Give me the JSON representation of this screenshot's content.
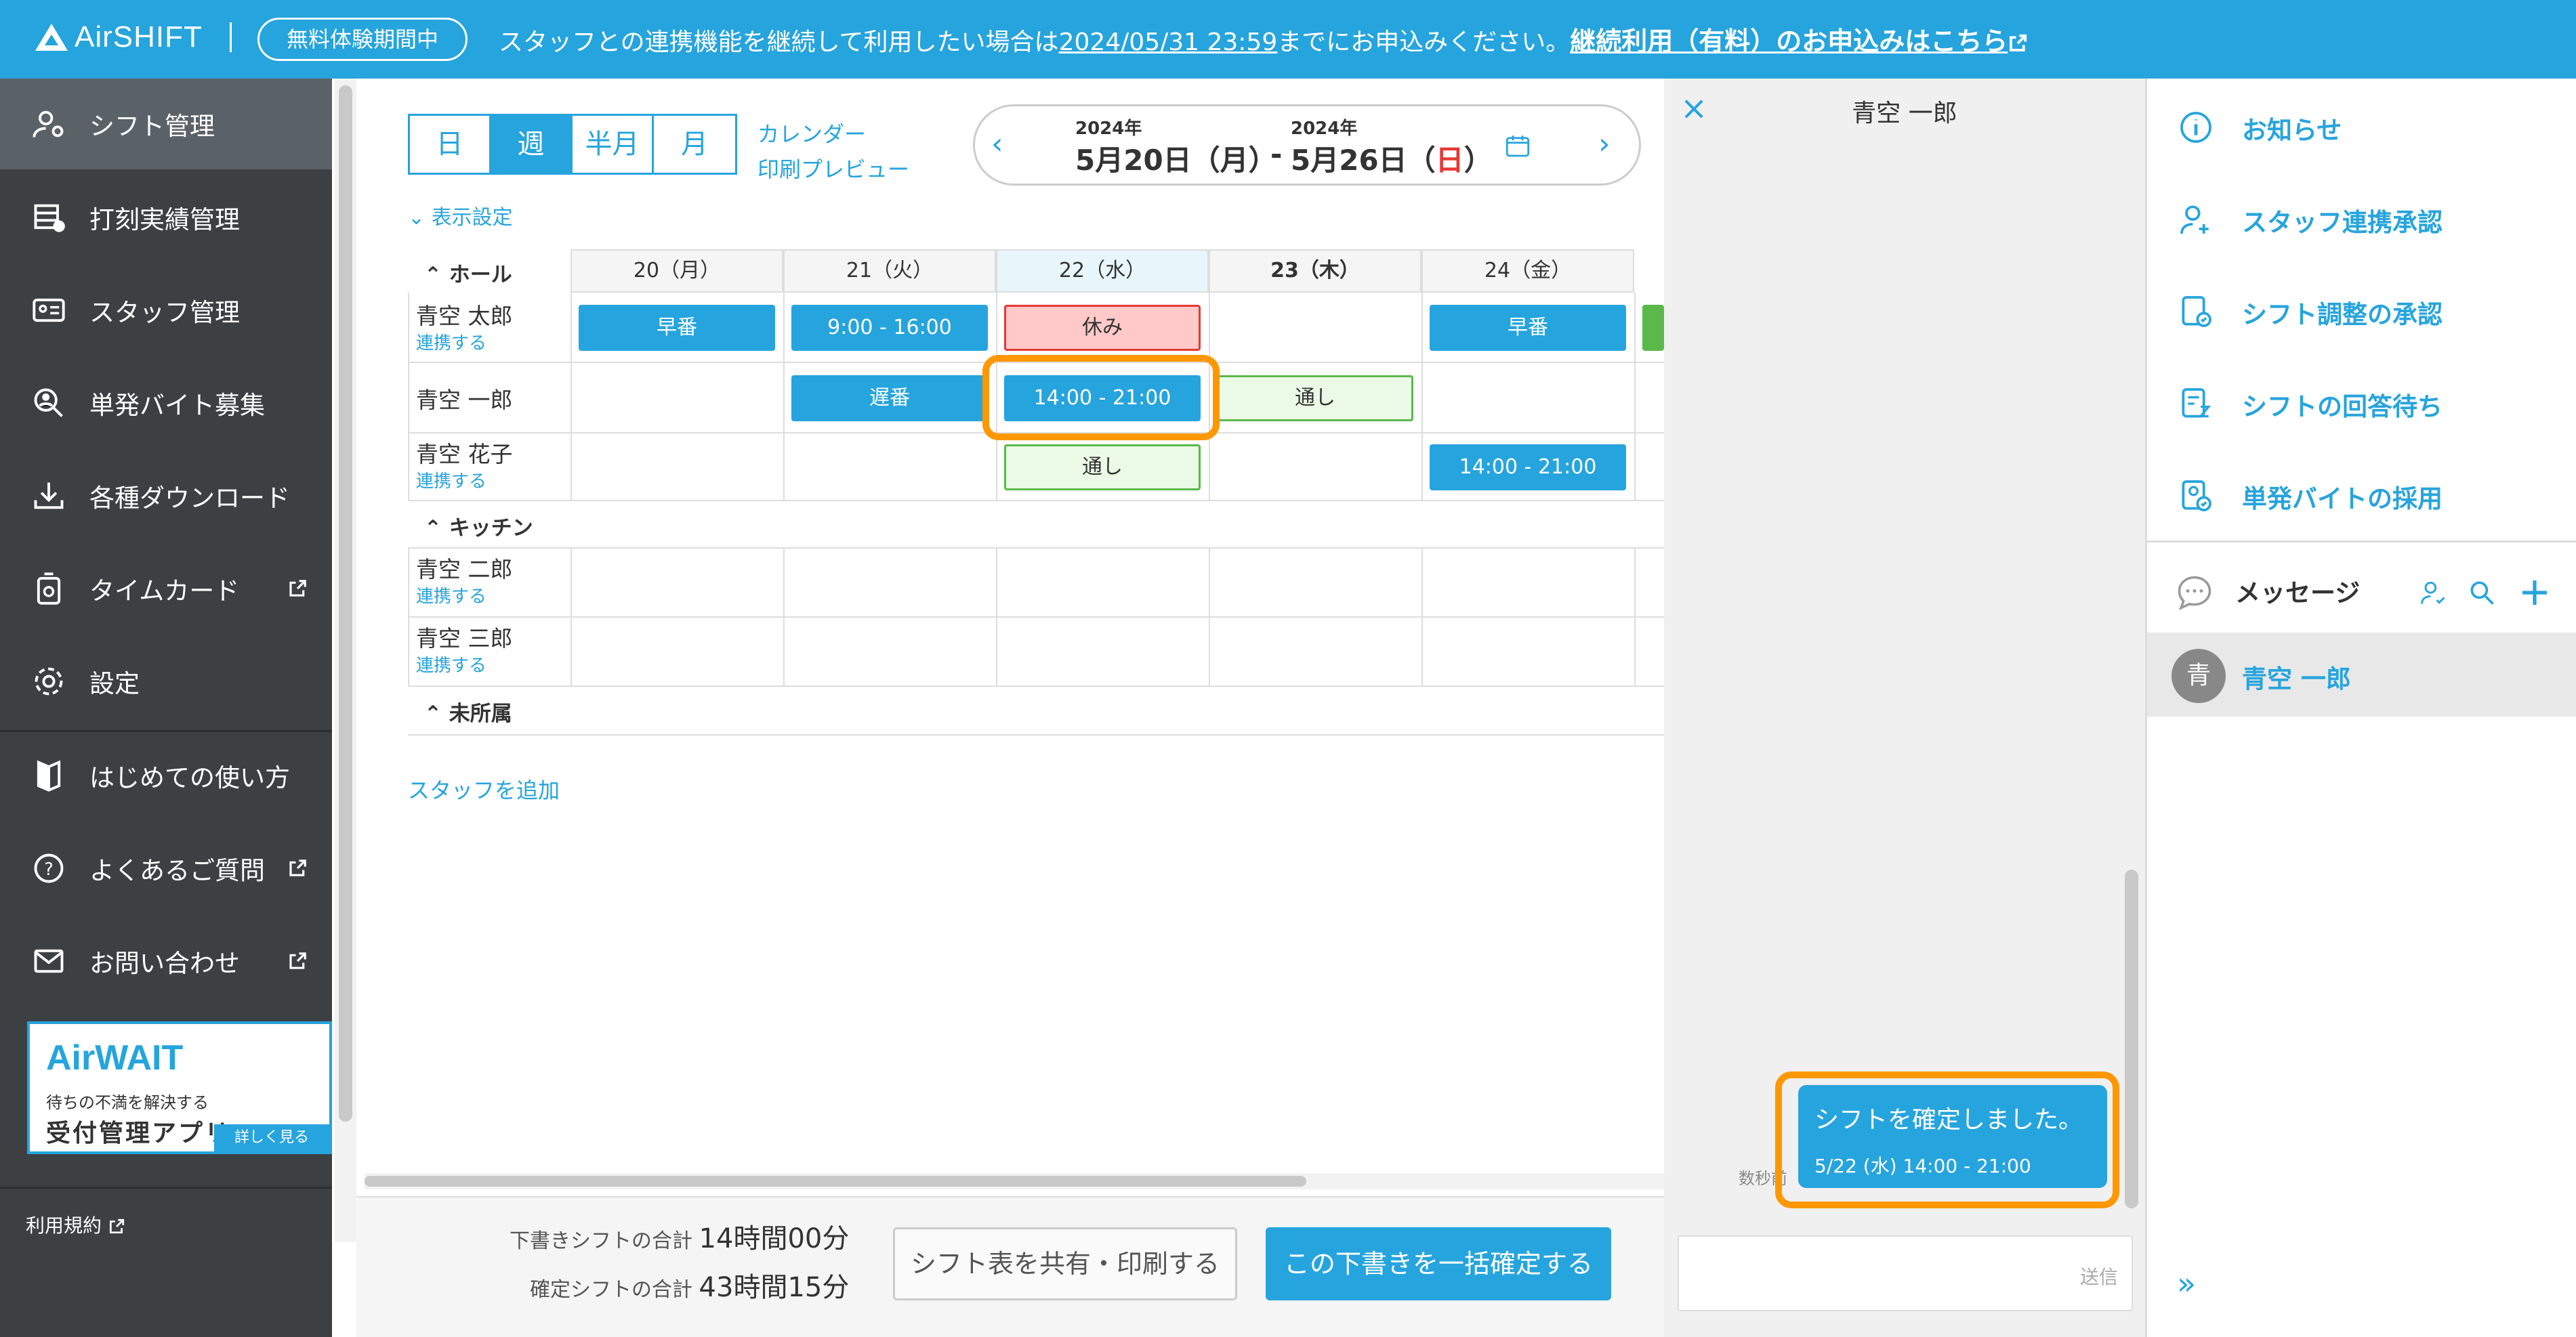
{
  "banner": {
    "logo": "AirSHIFT",
    "trial_badge": "無料体験期間中",
    "notice_prefix": "スタッフとの連携機能を継続して利用したい場合は",
    "notice_deadline": "2024/05/31 23:59",
    "notice_middle": "までにお申込みください。",
    "notice_link": "継続利用（有料）のお申込みはこちら"
  },
  "sidebar": {
    "items": [
      {
        "label": "シフト管理",
        "icon": "person-gear-icon"
      },
      {
        "label": "打刻実績管理",
        "icon": "timesheet-icon"
      },
      {
        "label": "スタッフ管理",
        "icon": "id-card-icon"
      },
      {
        "label": "単発バイト募集",
        "icon": "person-search-icon"
      },
      {
        "label": "各種ダウンロード",
        "icon": "download-icon"
      },
      {
        "label": "タイムカード",
        "icon": "timecard-icon"
      },
      {
        "label": "設定",
        "icon": "gear-icon"
      },
      {
        "label": "はじめての使い方",
        "icon": "book-icon"
      },
      {
        "label": "よくあるご質問",
        "icon": "question-icon"
      },
      {
        "label": "お問い合わせ",
        "icon": "mail-icon"
      }
    ],
    "ad": {
      "title": "AirWAIT",
      "line1": "待ちの不満を解決する",
      "line2": "受付管理アプリ",
      "more": "詳しく見る"
    },
    "terms": "利用規約"
  },
  "toolbar": {
    "views": [
      "日",
      "週",
      "半月",
      "月"
    ],
    "calendar_label": "カレンダー",
    "print_preview_label": "印刷プレビュー",
    "start_year": "2024年",
    "end_year": "2024年",
    "start_date": "5月20日（月）",
    "separator": "-",
    "end_date_prefix": "5月26日（",
    "end_date_day": "日",
    "end_date_suffix": "）",
    "display_settings": "表示設定"
  },
  "schedule": {
    "days": [
      "20（月）",
      "21（火）",
      "22（水）",
      "23（木）",
      "24（金）"
    ],
    "sections": [
      "ホール",
      "キッチン",
      "未所属"
    ],
    "link_text": "連携する",
    "staff": [
      {
        "name": "青空 太郎",
        "shifts": [
          "早番",
          "9:00 - 16:00",
          "休み",
          "",
          "早番"
        ]
      },
      {
        "name": "青空 一郎",
        "shifts": [
          "",
          "遅番",
          "14:00 - 21:00",
          "通し",
          ""
        ]
      },
      {
        "name": "青空 花子",
        "shifts": [
          "",
          "",
          "通し",
          "",
          "14:00 - 21:00"
        ]
      },
      {
        "name": "青空 二郎",
        "shifts": []
      },
      {
        "name": "青空 三郎",
        "shifts": []
      }
    ],
    "add_staff": "スタッフを追加"
  },
  "footer": {
    "draft_label": "下書きシフトの合計",
    "draft_value": "14時間00分",
    "confirmed_label": "確定シフトの合計",
    "confirmed_value": "43時間15分",
    "share_button": "シフト表を共有・印刷する",
    "confirm_button": "この下書きを一括確定する"
  },
  "chat": {
    "title": "青空 一郎",
    "message": "シフトを確定しました。",
    "message_detail": "5/22 (水) 14:00 - 21:00",
    "time_ago": "数秒前",
    "send": "送信"
  },
  "right_panel": {
    "items": [
      {
        "label": "お知らせ",
        "icon": "info-icon"
      },
      {
        "label": "スタッフ連携承認",
        "icon": "person-add-icon"
      },
      {
        "label": "シフト調整の承認",
        "icon": "doc-check-icon"
      },
      {
        "label": "シフトの回答待ち",
        "icon": "doc-wait-icon"
      },
      {
        "label": "単発バイトの採用",
        "icon": "person-check-icon"
      }
    ],
    "messages_label": "メッセージ",
    "chat_contact": "青空 一郎",
    "avatar_initial": "青"
  },
  "colors": {
    "accent": "#26a4dd",
    "highlight": "#ff9800",
    "holiday": "#e53935",
    "off": "#ffc9c9",
    "full": "#ebfae6"
  }
}
